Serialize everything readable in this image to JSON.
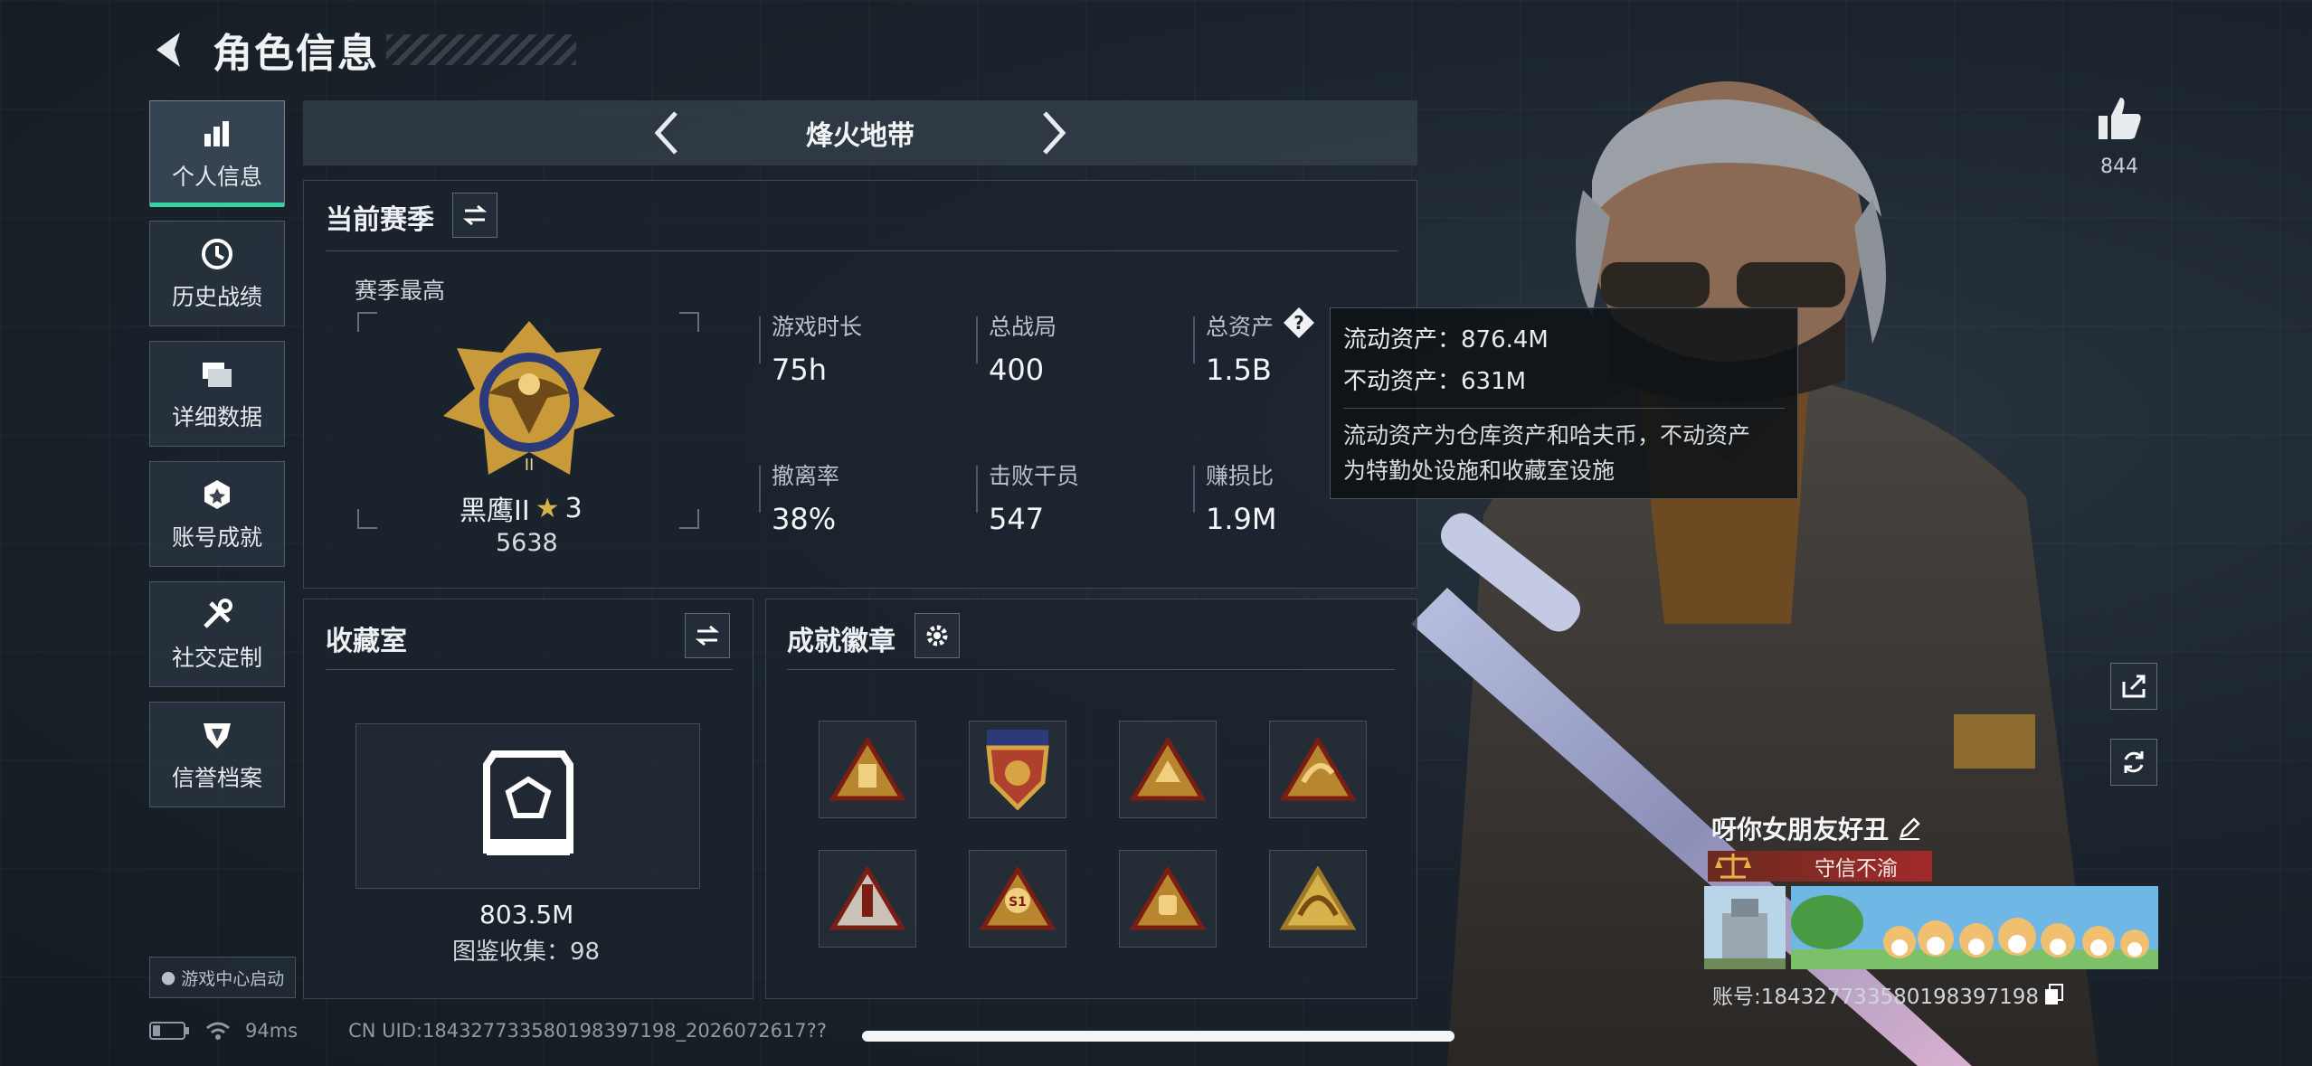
{
  "header": {
    "title": "角色信息"
  },
  "nav": {
    "items": [
      {
        "label": "个人信息",
        "icon": "bar-chart-icon",
        "active": true
      },
      {
        "label": "历史战绩",
        "icon": "history-clock-icon"
      },
      {
        "label": "详细数据",
        "icon": "folders-icon"
      },
      {
        "label": "账号成就",
        "icon": "achievement-icon"
      },
      {
        "label": "社交定制",
        "icon": "tools-icon"
      },
      {
        "label": "信誉档案",
        "icon": "shield-icon"
      }
    ],
    "game_center": "游戏中心启动"
  },
  "mode": {
    "name": "烽火地带"
  },
  "season": {
    "title": "当前赛季",
    "best_label": "赛季最高",
    "rank_name": "黑鹰II",
    "rank_stars": "3",
    "rank_score": "5638",
    "stats": [
      {
        "label": "游戏时长",
        "value": "75h"
      },
      {
        "label": "总战局",
        "value": "400"
      },
      {
        "label": "总资产",
        "value": "1.5B"
      },
      {
        "label": "撤离率",
        "value": "38%"
      },
      {
        "label": "击败干员",
        "value": "547"
      },
      {
        "label": "赚损比",
        "value": "1.9M"
      }
    ]
  },
  "tooltip": {
    "liquid": "流动资产：876.4M",
    "fixed": "不动资产：631M",
    "desc_line1": "流动资产为仓库资产和哈夫币，不动资产",
    "desc_line2": "为特勤处设施和收藏室设施"
  },
  "collection": {
    "title": "收藏室",
    "value": "803.5M",
    "sub": "图鉴收集：98"
  },
  "badges": {
    "title": "成就徽章",
    "count": 8
  },
  "profile": {
    "likes": "844",
    "player_name": "呀你女朋友好丑",
    "trust": "守信不渝",
    "account_id": "账号:184327733580198397198"
  },
  "status": {
    "ping": "94ms",
    "uid": "CN UID:184327733580198397198_2026072617??"
  },
  "colors": {
    "accent": "#37d0a1",
    "gold": "#c99a3a",
    "trust_red": "#a12a2a"
  }
}
